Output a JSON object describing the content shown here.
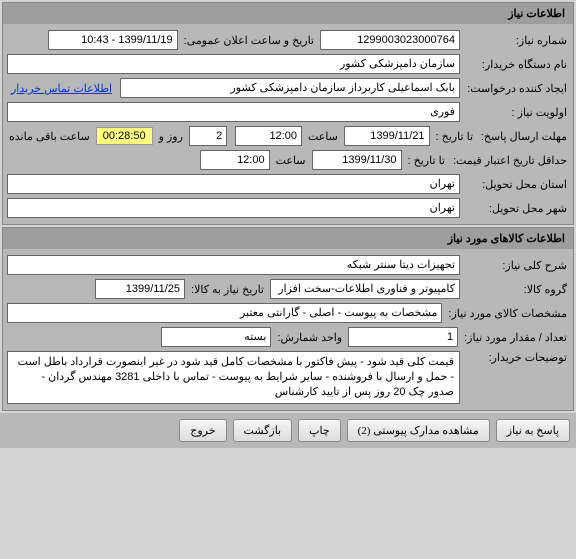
{
  "panel1": {
    "title": "اطلاعات نیاز",
    "need_number_label": "شماره نیاز:",
    "need_number": "1299003023000764",
    "announce_label": "تاریخ و ساعت اعلان عمومی:",
    "announce_value": "1399/11/19 - 10:43",
    "org_label": "نام دستگاه خریدار:",
    "org_value": "سازمان دامپزشکی کشور",
    "requester_label": "ایجاد کننده درخواست:",
    "requester_value": "بابک اسماعیلی کاربرداز سازمان دامپزشکی کشور",
    "buyer_contact_link": "اطلاعات تماس خریدار",
    "priority_label": "اولویت نیاز :",
    "priority_value": "فوری",
    "deadline_send_label": "مهلت ارسال پاسخ:",
    "to_date_label": "تا تاریخ :",
    "deadline_date": "1399/11/21",
    "time_label": "ساعت",
    "deadline_time": "12:00",
    "days_value": "2",
    "days_label": "روز و",
    "countdown": "00:28:50",
    "remaining_label": "ساعت باقی مانده",
    "min_credit_label": "حداقل تاریخ اعتبار قیمت:",
    "min_credit_date": "1399/11/30",
    "min_credit_time": "12:00",
    "delivery_province_label": "استان محل تحویل:",
    "delivery_province": "تهران",
    "delivery_city_label": "شهر محل تحویل:",
    "delivery_city": "تهران"
  },
  "panel2": {
    "title": "اطلاعات کالاهای مورد نیاز",
    "desc_label": "شرح کلی نیاز:",
    "desc_value": "تجهیزات دیتا سنتر شبکه",
    "group_label": "گروه کالا:",
    "group_value": "کامپیوتر و فناوری اطلاعات-سخت افزار",
    "need_date_label": "تاریخ نیاز به کالا:",
    "need_date_value": "1399/11/25",
    "spec_label": "مشخصات کالای مورد نیاز:",
    "spec_value": "مشخصات به پیوست -  اصلی - گارانتی معتبر",
    "qty_label": "تعداد / مقدار مورد نیاز:",
    "qty_value": "1",
    "unit_label": "واحد شمارش:",
    "unit_value": "بسته",
    "buyer_notes_label": "توضیحات خریدار:",
    "buyer_notes_value": "قیمت کلی قید شود - پیش فاکتور با مشخصات کامل قید شود  در غیر اینصورت قرارداد باطل است - حمل و ارسال با فروشنده - سایر شرایط به پیوست - تماس با داخلی 3281 مهندس گردان - صدور چک 20 روز پس از تایید کارشناس"
  },
  "buttons": {
    "respond": "پاسخ به نیاز",
    "view_attach": "مشاهده مدارک پیوستی (2)",
    "print": "چاپ",
    "back": "بازگشت",
    "exit": "خروج"
  }
}
